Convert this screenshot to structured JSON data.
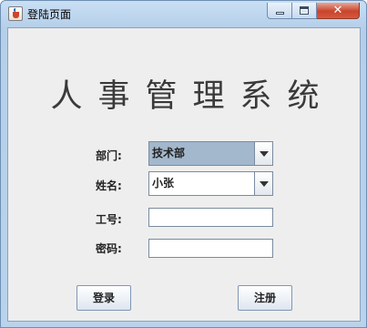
{
  "window": {
    "title": "登陆页面",
    "close_symbol": "✕"
  },
  "heading": "人事管理系统",
  "form": {
    "department": {
      "label": "部门:",
      "value": "技术部"
    },
    "name": {
      "label": "姓名:",
      "value": "小张"
    },
    "employee_id": {
      "label": "工号:",
      "value": ""
    },
    "password": {
      "label": "密码:",
      "value": ""
    }
  },
  "buttons": {
    "login": "登录",
    "register": "注册"
  },
  "icons": [
    "java-app-icon",
    "minimize-icon",
    "maximize-icon",
    "close-icon",
    "chevron-down-icon"
  ]
}
